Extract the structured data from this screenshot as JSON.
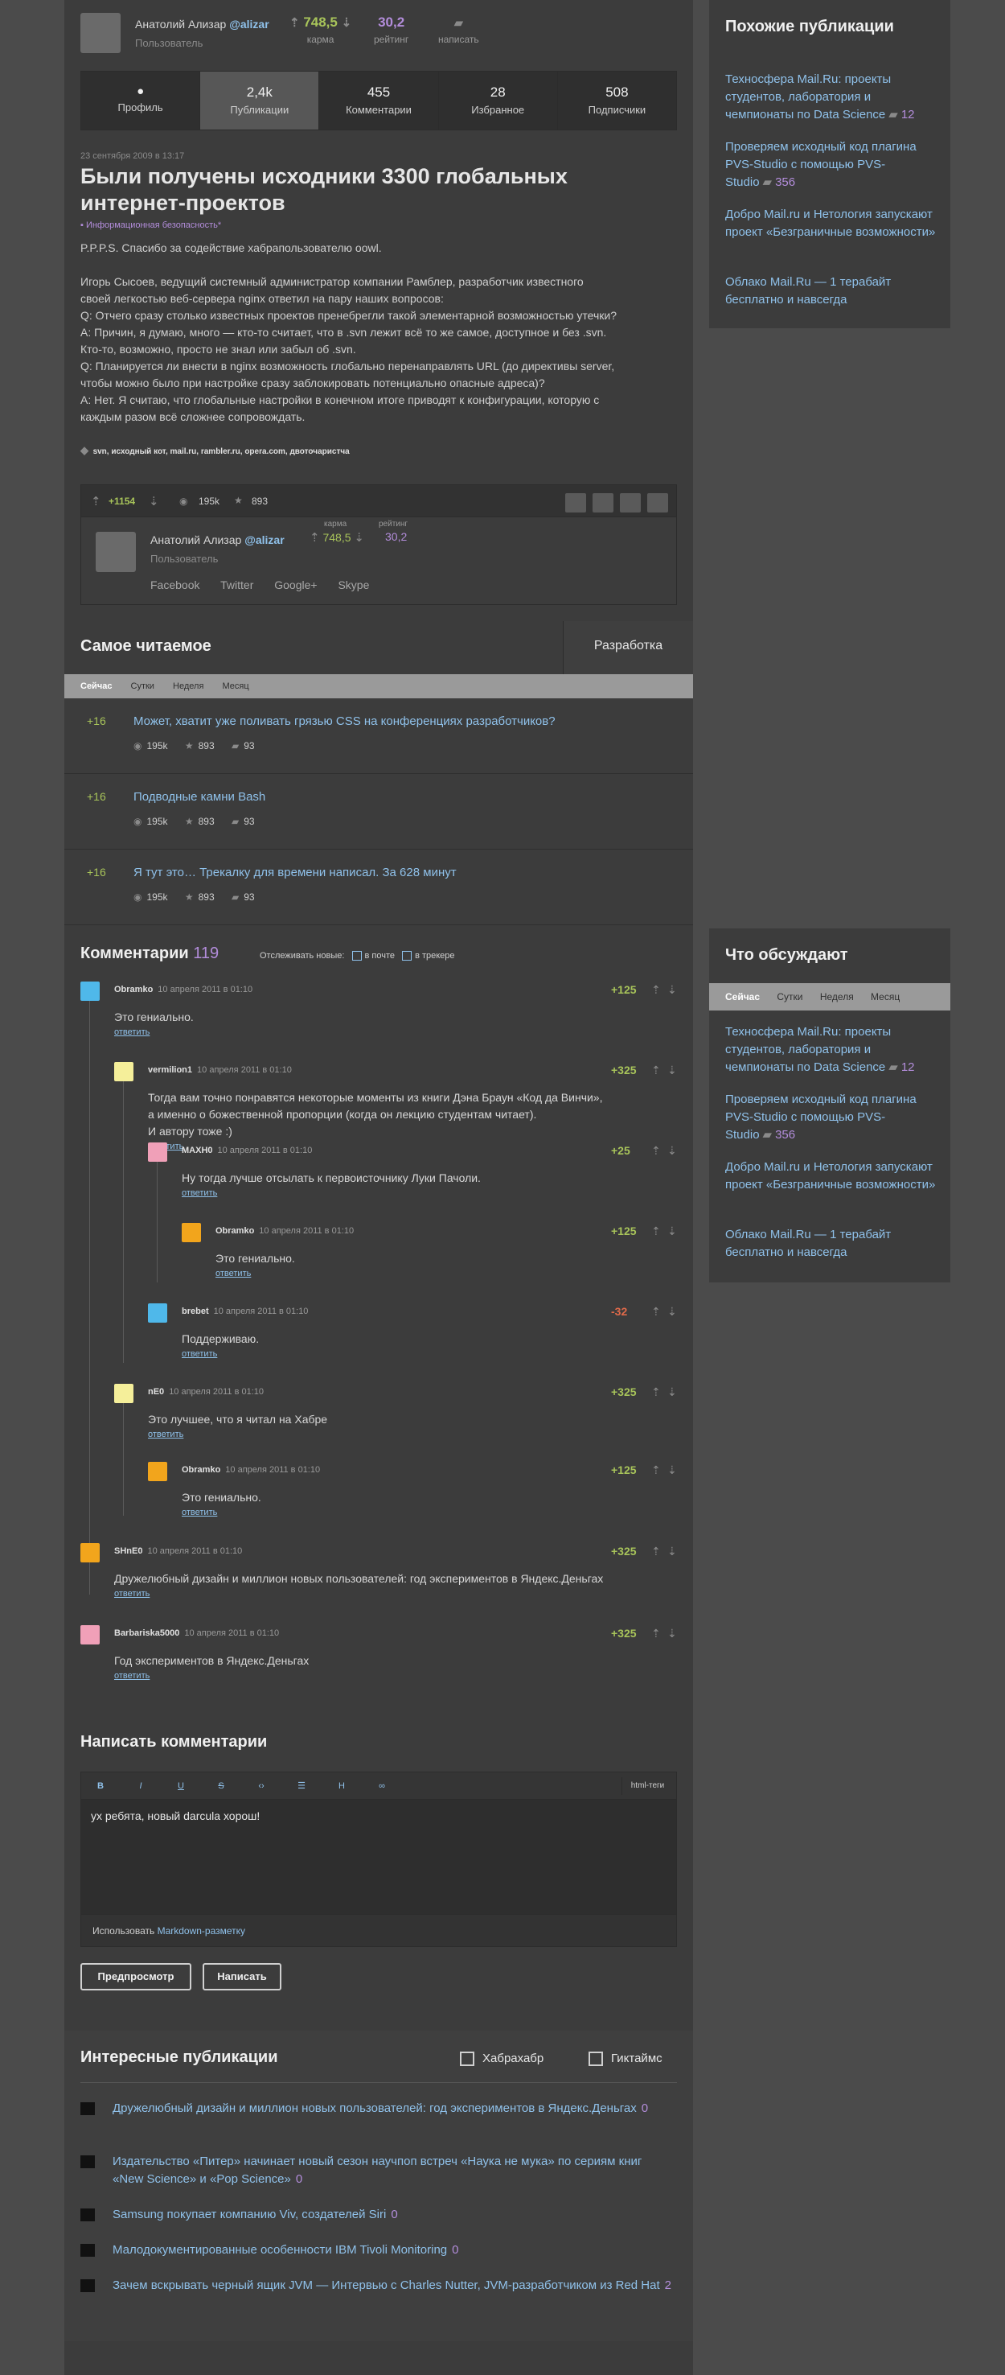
{
  "author": {
    "name": "Анатолий Ализар",
    "nick": "@alizar",
    "role": "Пользователь",
    "karma": "748,5",
    "karma_label": "карма",
    "rating": "30,2",
    "rating_label": "рейтинг",
    "write_label": "написать"
  },
  "profile_tabs": [
    {
      "count": "",
      "label": "Профиль"
    },
    {
      "count": "2,4k",
      "label": "Публикации"
    },
    {
      "count": "455",
      "label": "Комментарии"
    },
    {
      "count": "28",
      "label": "Избранное"
    },
    {
      "count": "508",
      "label": "Подписчики"
    }
  ],
  "post": {
    "date": "23 сентября 2009 в 13:17",
    "title": "Были получены исходники 3300 глобальных интернет-проектов",
    "hub": "Информационная безопасность*",
    "body": [
      "P.P.P.S. Спасибо за содействие хабрапользователю oowl.",
      "",
      "Игорь Сысоев, ведущий системный администратор компании Рамблер, разработчик известного",
      "своей легкостью веб-сервера nginx ответил на пару наших вопросов:",
      "Q: Отчего сразу столько известных проектов пренебрегли такой элементарной возможностью утечки?",
      "A: Причин, я думаю, много — кто-то считает, что в .svn лежит всё то же самое, доступное и без .svn.",
      "Кто-то, возможно, просто не знал или забыл об .svn.",
      "Q: Планируется ли внести в nginx возможность глобально перенаправлять URL (до директивы server,",
      "чтобы можно было при настройке сразу заблокировать потенциально опасные адреса)?",
      "A: Нет. Я считаю, что глобальные настройки в конечном итоге приводят к конфигурации, которую с",
      "каждым разом всё сложнее сопровождать."
    ],
    "tags": "svn, исходный кот, mail.ru, rambler.ru, opera.com, двоточаристча",
    "score": "+1154",
    "views": "195k",
    "favs": "893"
  },
  "author_card": {
    "name": "Анатолий Ализар",
    "nick": "@alizar",
    "role": "Пользователь",
    "karma_label": "карма",
    "karma": "748,5",
    "rating_label": "рейтинг",
    "rating": "30,2",
    "links": [
      "Facebook",
      "Twitter",
      "Google+",
      "Skype"
    ]
  },
  "most_read": {
    "title": "Самое читаемое",
    "alt_tab": "Разработка",
    "periods": [
      "Сейчас",
      "Сутки",
      "Неделя",
      "Месяц"
    ],
    "items": [
      {
        "score": "+16",
        "title": "Может, хватит уже поливать грязью CSS на конференциях разработчиков?",
        "views": "195k",
        "favs": "893",
        "comments": "93"
      },
      {
        "score": "+16",
        "title": "Подводные камни Bash",
        "views": "195k",
        "favs": "893",
        "comments": "93"
      },
      {
        "score": "+16",
        "title": "Я тут это… Трекалку для времени написал. За 628 минут",
        "views": "195k",
        "favs": "893",
        "comments": "93"
      }
    ]
  },
  "comments": {
    "title": "Комментарии",
    "count": "119",
    "track_label": "Отслеживать новые:",
    "track_mail": "в почте",
    "track_tracker": "в трекере",
    "reply_label": "ответить",
    "list": [
      {
        "user": "Obramko",
        "date": "10 апреля 2011 в 01:10",
        "score": "+125",
        "text": "Это гениально.",
        "color": "#4fb8ea"
      },
      {
        "user": "vermilion1",
        "date": "10 апреля 2011 в 01:10",
        "score": "+325",
        "text": "Тогда вам точно понравятся некоторые моменты из книги Дэна Браун «Код да Винчи»,\nа именно о божественной пропорции (когда он лекцию студентам читает).\nИ автору тоже :)",
        "color": "#f5ef9a"
      },
      {
        "user": "MAXH0",
        "date": "10 апреля 2011 в 01:10",
        "score": "+25",
        "text": "Ну тогда лучше отсылать к первоисточнику Луки Пачоли.",
        "color": "#f0a0b8"
      },
      {
        "user": "Obramko",
        "date": "10 апреля 2011 в 01:10",
        "score": "+125",
        "text": "Это гениально.",
        "color": "#f2a51c"
      },
      {
        "user": "brebet",
        "date": "10 апреля 2011 в 01:10",
        "score": "-32",
        "text": "Поддерживаю.",
        "color": "#4fb8ea"
      },
      {
        "user": "nE0",
        "date": "10 апреля 2011 в 01:10",
        "score": "+325",
        "text": "Это лучшее, что я читал на Хабре",
        "color": "#f5ef9a"
      },
      {
        "user": "Obramko",
        "date": "10 апреля 2011 в 01:10",
        "score": "+125",
        "text": "Это гениально.",
        "color": "#f2a51c"
      },
      {
        "user": "SHnE0",
        "date": "10 апреля 2011 в 01:10",
        "score": "+325",
        "text": "Дружелюбный дизайн и миллион новых пользователей: год экспериментов в Яндекс.Деньгах",
        "color": "#f2a51c"
      },
      {
        "user": "Barbariska5000",
        "date": "10 апреля 2011 в 01:10",
        "score": "+325",
        "text": "Год экспериментов в Яндекс.Деньгах",
        "color": "#f0a0b8"
      }
    ]
  },
  "write": {
    "title": "Написать комментарии",
    "html_tags": "html-теги",
    "text": "ух ребята, новый darcula хорош!",
    "markdown_prefix": "Использовать",
    "markdown_link": "Markdown-разметку",
    "preview": "Предпросмотр",
    "submit": "Написать"
  },
  "interesting": {
    "title": "Интересные публикации",
    "opt1": "Хабрахабр",
    "opt2": "Гиктаймс",
    "items": [
      {
        "title": "Дружелюбный дизайн и миллион новых пользователей: год экспериментов в Яндекс.Деньгах",
        "count": "0"
      },
      {
        "title": "Издательство «Питер» начинает новый сезон научпоп встреч «Наука не мука» по сериям книг «New Science» и «Pop Science»",
        "count": "0"
      },
      {
        "title": "Samsung покупает компанию Viv, создателей Siri",
        "count": "0"
      },
      {
        "title": "Малодокументированные особенности IBM Tivoli Monitoring",
        "count": "0"
      },
      {
        "title": "Зачем вскрывать черный ящик JVM — Интервью с Charles Nutter, JVM-разработчиком из Red Hat",
        "count": "2"
      }
    ]
  },
  "similar": {
    "title": "Похожие публикации",
    "items": [
      {
        "title": "Техносфера Mail.Ru: проекты студентов, лаборатория и чемпионаты по Data Science",
        "count": "12"
      },
      {
        "title": "Проверяем исходный код плагина PVS-Studio с помощью PVS-Studio",
        "count": "356"
      },
      {
        "title": "Добро Mail.ru и Нетология запускают проект «Безграничные возможности»",
        "count": ""
      },
      {
        "title": "Облако Mail.Ru — 1 терабайт бесплатно и навсегда",
        "count": ""
      }
    ]
  },
  "discussed": {
    "title": "Что обсуждают",
    "periods": [
      "Сейчас",
      "Сутки",
      "Неделя",
      "Месяц"
    ],
    "items": [
      {
        "title": "Техносфера Mail.Ru: проекты студентов, лаборатория и чемпионаты по Data Science",
        "count": "12"
      },
      {
        "title": "Проверяем исходный код плагина PVS-Studio с помощью PVS-Studio",
        "count": "356"
      },
      {
        "title": "Добро Mail.ru и Нетология запускают проект «Безграничные возможности»",
        "count": ""
      },
      {
        "title": "Облако Mail.Ru — 1 терабайт бесплатно и навсегда",
        "count": ""
      }
    ]
  }
}
